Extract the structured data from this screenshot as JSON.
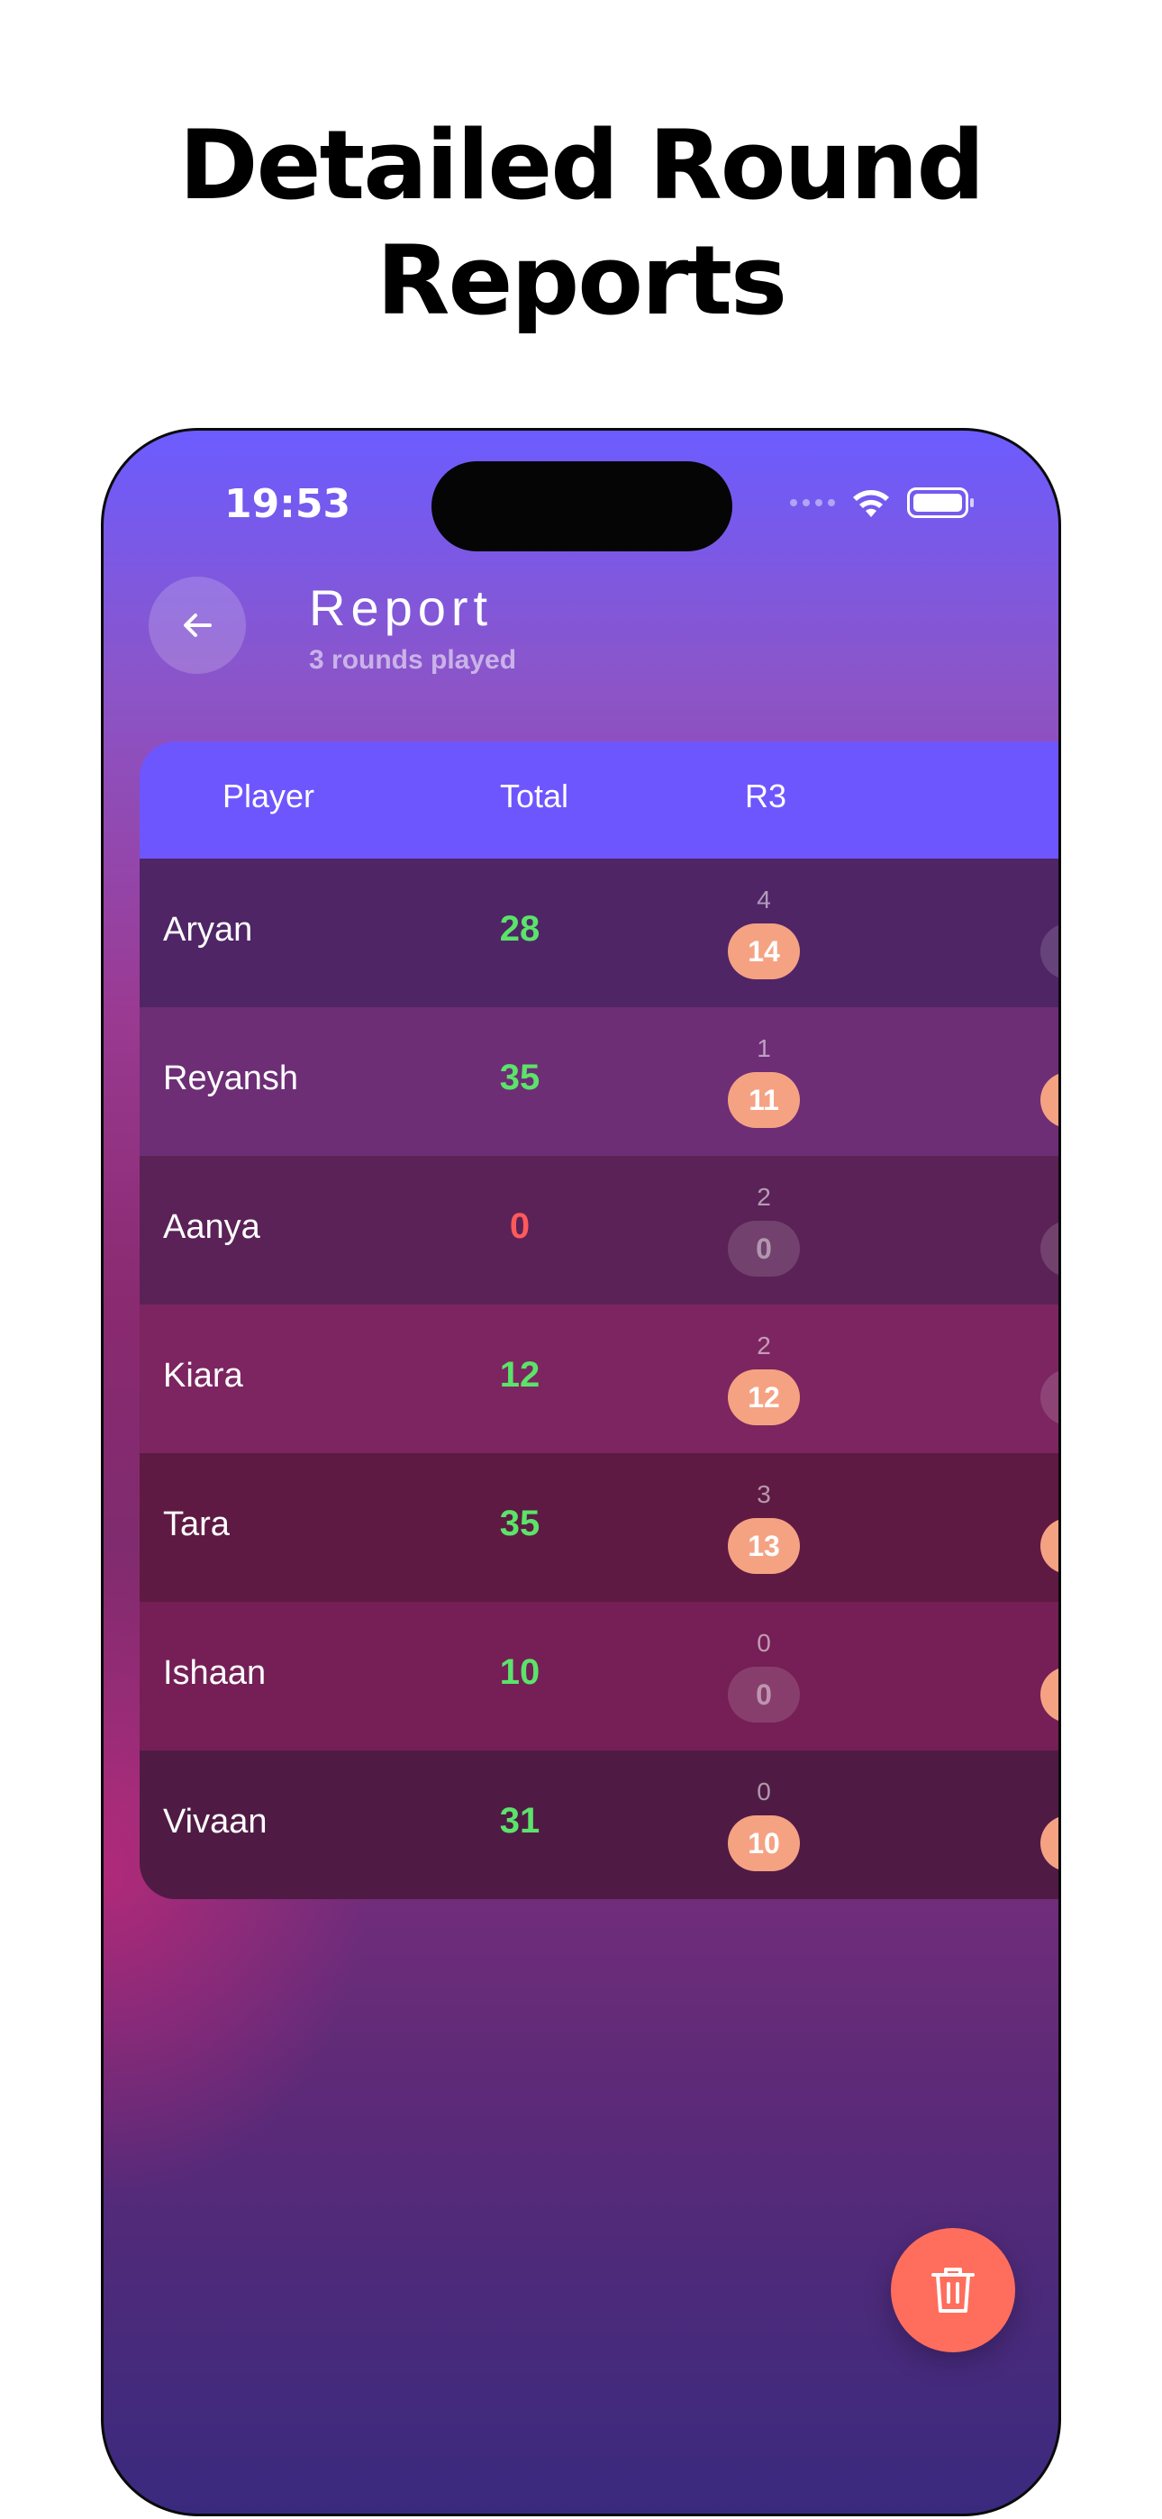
{
  "headline": {
    "line1": "Detailed Round",
    "line2": "Reports"
  },
  "status_bar": {
    "time": "19:53",
    "icons": [
      "cellular-signal-icon",
      "wifi-icon",
      "battery-icon"
    ]
  },
  "header": {
    "back_icon": "arrow-left-icon",
    "title": "Report",
    "subtitle": "3 rounds played"
  },
  "table": {
    "columns": [
      "Player",
      "Total",
      "R3"
    ],
    "rows": [
      {
        "name": "Aryan",
        "total": "28",
        "round_small": "4",
        "round_pill": "14",
        "pill_active": true,
        "next_active": false
      },
      {
        "name": "Reyansh",
        "total": "35",
        "round_small": "1",
        "round_pill": "11",
        "pill_active": true,
        "next_active": true
      },
      {
        "name": "Aanya",
        "total": "0",
        "round_small": "2",
        "round_pill": "0",
        "pill_active": false,
        "next_active": false
      },
      {
        "name": "Kiara",
        "total": "12",
        "round_small": "2",
        "round_pill": "12",
        "pill_active": true,
        "next_active": false
      },
      {
        "name": "Tara",
        "total": "35",
        "round_small": "3",
        "round_pill": "13",
        "pill_active": true,
        "next_active": true
      },
      {
        "name": "Ishaan",
        "total": "10",
        "round_small": "0",
        "round_pill": "0",
        "pill_active": false,
        "next_active": true
      },
      {
        "name": "Vivaan",
        "total": "31",
        "round_small": "0",
        "round_pill": "10",
        "pill_active": true,
        "next_active": true
      }
    ]
  },
  "fab": {
    "icon": "trash-icon"
  },
  "colors": {
    "header_row": "#6e56ff",
    "positive_total": "#5be36a",
    "zero_total": "#ff5a5a",
    "pill_active": "#f5a283",
    "fab": "#ff6e5c"
  }
}
